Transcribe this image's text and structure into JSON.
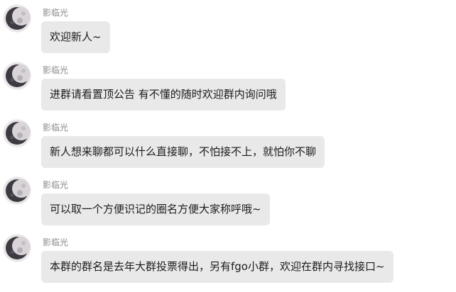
{
  "conversation": {
    "messages": [
      {
        "sender": "影临光",
        "text": "欢迎新人~",
        "avatar_icon": "moon-avatar-icon"
      },
      {
        "sender": "影临光",
        "text": "进群请看置顶公告 有不懂的随时欢迎群内询问哦",
        "avatar_icon": "moon-avatar-icon"
      },
      {
        "sender": "影临光",
        "text": "新人想来聊都可以什么直接聊，不怕接不上，就怕你不聊",
        "avatar_icon": "moon-avatar-icon"
      },
      {
        "sender": "影临光",
        "text": "可以取一个方便识记的圈名方便大家称呼哦~",
        "avatar_icon": "moon-avatar-icon"
      },
      {
        "sender": "影临光",
        "text": "本群的群名是去年大群投票得出，另有fgo小群，欢迎在群内寻找接口~",
        "avatar_icon": "moon-avatar-icon"
      }
    ]
  },
  "colors": {
    "background": "#ffffff",
    "bubble": "#e9e9e9",
    "sender_text": "#8a8a8a",
    "message_text": "#1c1c1c"
  }
}
